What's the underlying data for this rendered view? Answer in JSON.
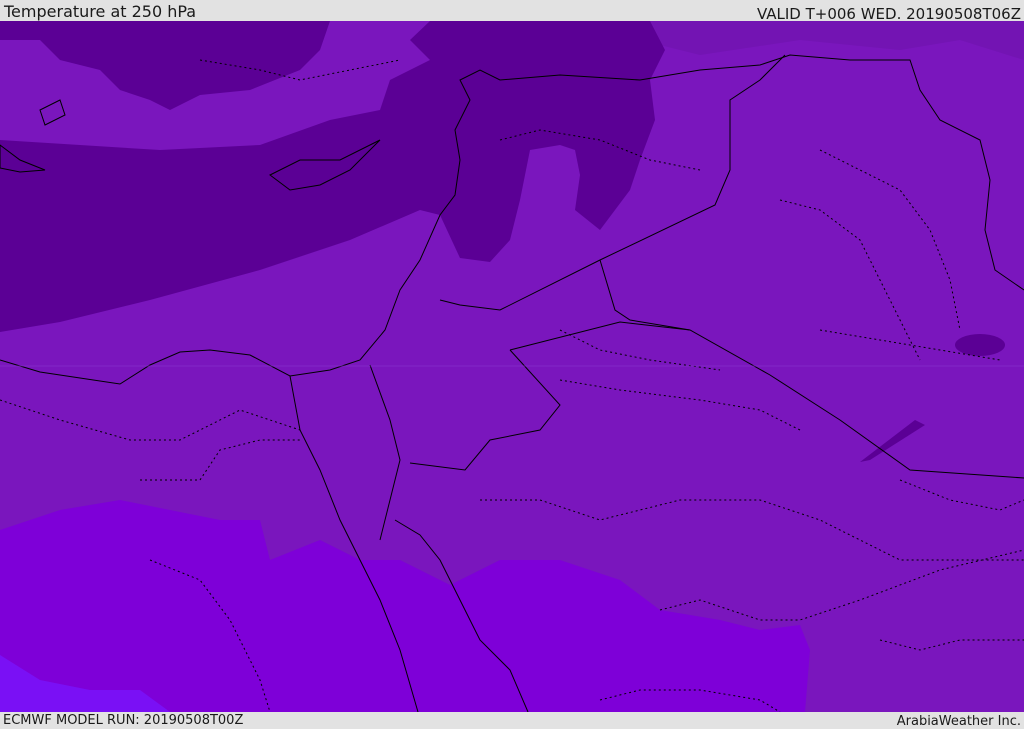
{
  "header": {
    "title": "Temperature at 250 hPa",
    "valid": "VALID T+006 WED. 20190508T06Z"
  },
  "footer": {
    "model_run": "ECMWF MODEL RUN: 20190508T00Z",
    "credit": "ArabiaWeather Inc."
  },
  "map": {
    "field": "Temperature at 250 hPa",
    "colors": {
      "coldest": "#5b0095",
      "cold": "#7314b3",
      "mid": "#7a16bd",
      "warm": "#7e00d8",
      "warmest": "#7a10f5",
      "boundary": "#000000"
    }
  }
}
